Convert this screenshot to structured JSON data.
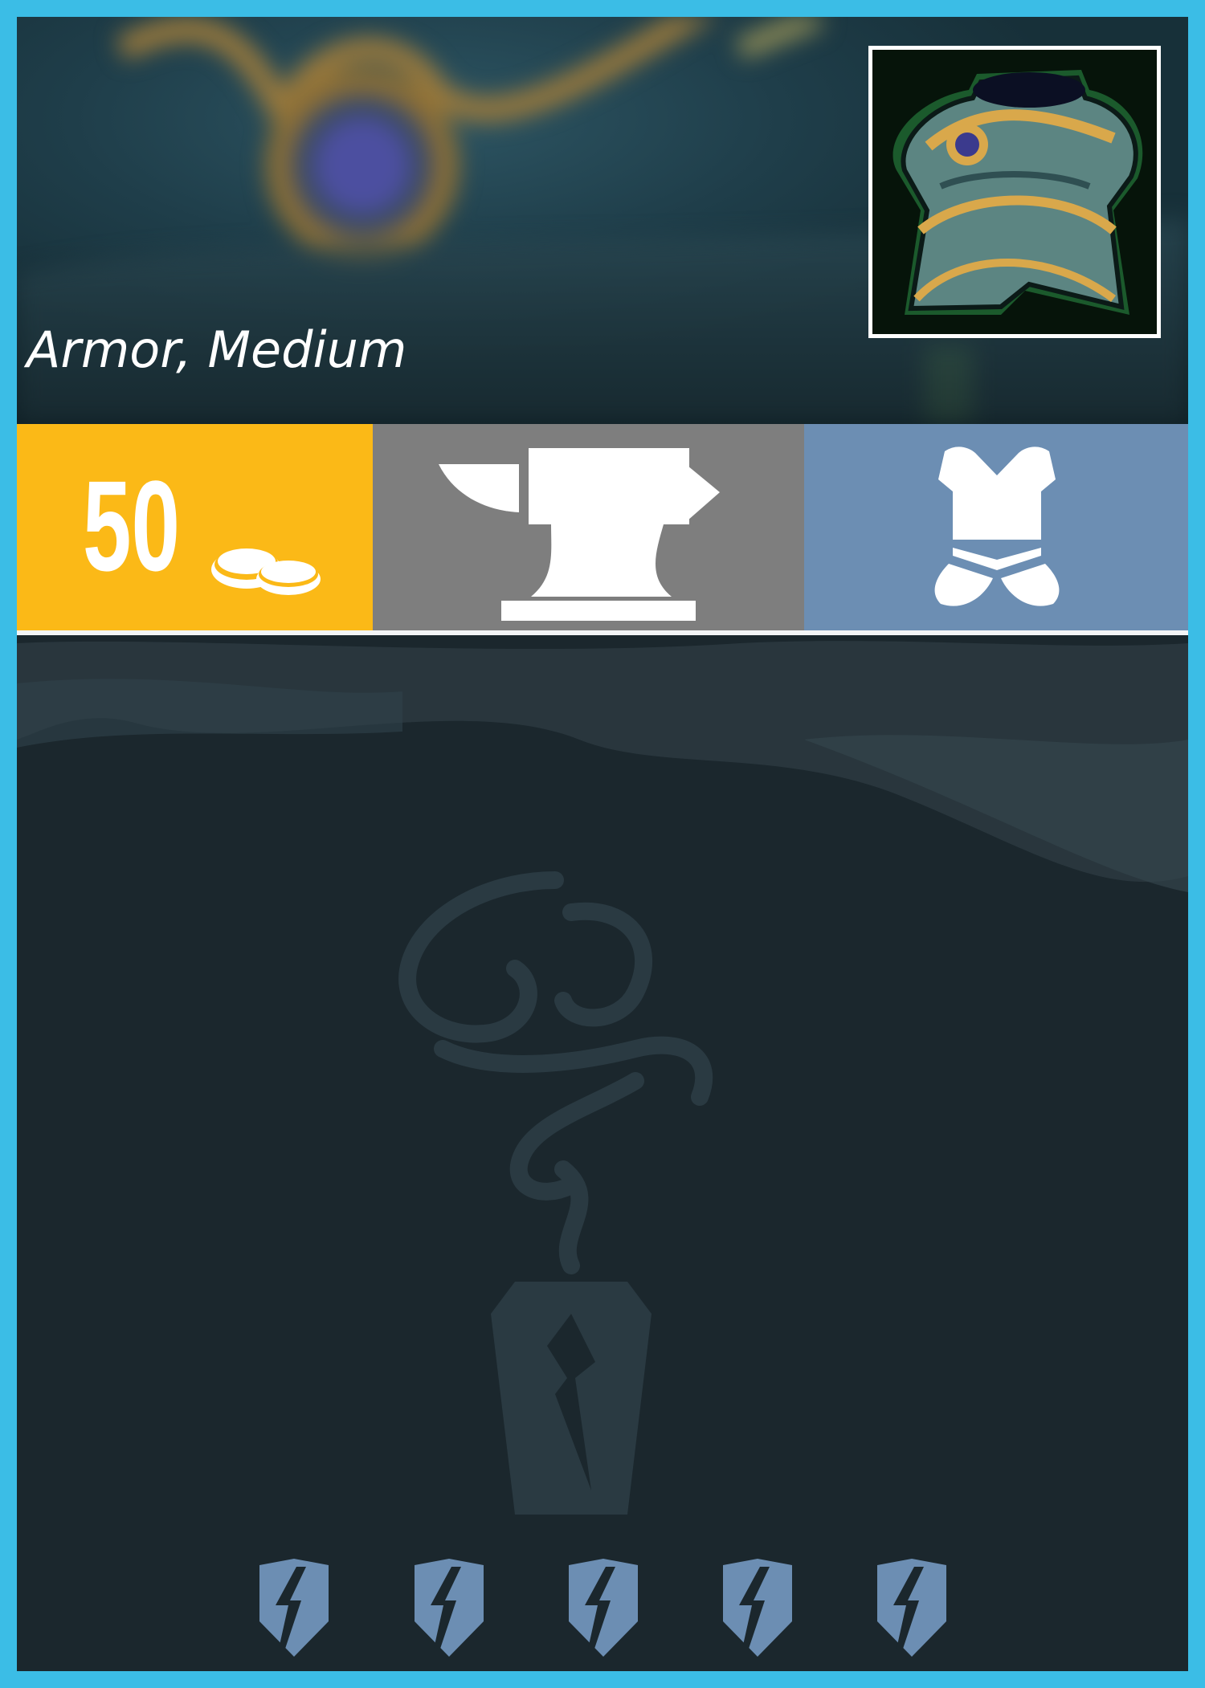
{
  "card": {
    "item_type": "Armor, Medium",
    "cost": "50",
    "cost_icon": "coins-icon",
    "crafting_icon": "anvil-icon",
    "category_icon": "medium-armor-icon",
    "portrait_icon": "medium-armor-portrait",
    "emblem_icon": "smoke-sigil-icon",
    "rating_icon": "lightning-shield-icon",
    "rating_count": 5
  },
  "colors": {
    "frame": "#3bbde6",
    "cost_bg": "#fbb917",
    "crafting_bg": "#7e7e7e",
    "category_bg": "#6c8eb3",
    "body_bg": "#1b272d",
    "shield": "#6c8eb3"
  }
}
